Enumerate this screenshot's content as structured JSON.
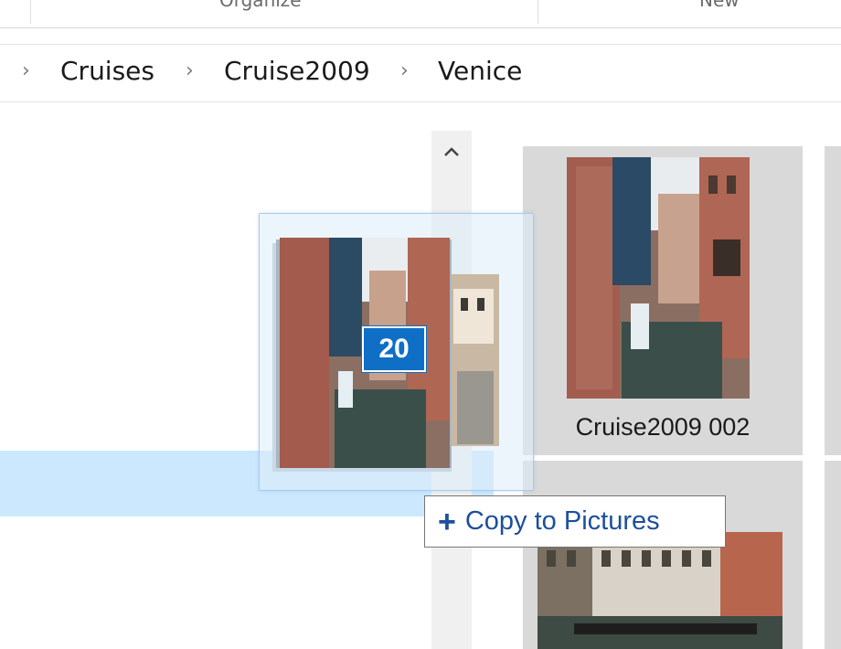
{
  "ribbon": {
    "groups": [
      "Organize",
      "New"
    ]
  },
  "breadcrumb": {
    "items": [
      "Cruises",
      "Cruise2009",
      "Venice"
    ]
  },
  "drag": {
    "count": "20",
    "tooltip": "Copy to Pictures"
  },
  "files": [
    {
      "name": "Cruise2009 002"
    }
  ],
  "colors": {
    "selection": "#cce8ff",
    "badge": "#0f6fc6",
    "tooltip_text": "#1d4f9c"
  }
}
